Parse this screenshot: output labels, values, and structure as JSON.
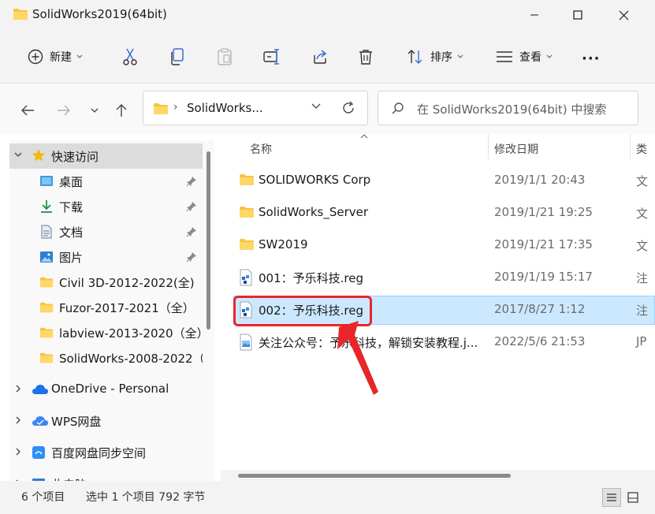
{
  "window": {
    "title": "SolidWorks2019(64bit)",
    "folder_color": "#f4c542"
  },
  "toolbar": {
    "new_label": "新建",
    "sort_label": "排序",
    "view_label": "查看",
    "more_label": "···"
  },
  "address": {
    "separator": "›",
    "path": "SolidWorks...",
    "search_placeholder": "在 SolidWorks2019(64bit) 中搜索"
  },
  "nav": {
    "quick_access": "快速访问",
    "items": [
      {
        "label": "桌面",
        "icon": "desktop-icon",
        "pinned": true
      },
      {
        "label": "下载",
        "icon": "download-icon",
        "pinned": true
      },
      {
        "label": "文档",
        "icon": "document-icon",
        "pinned": true
      },
      {
        "label": "图片",
        "icon": "pictures-icon",
        "pinned": true
      },
      {
        "label": "Civil 3D-2012-2022(全)",
        "icon": "folder-icon",
        "pinned": false
      },
      {
        "label": "Fuzor-2017-2021（全）",
        "icon": "folder-icon",
        "pinned": false
      },
      {
        "label": "labview-2013-2020（全）",
        "icon": "folder-icon",
        "pinned": false
      },
      {
        "label": "SolidWorks-2008-2022（",
        "icon": "folder-icon",
        "pinned": false
      }
    ],
    "onedrive": "OneDrive - Personal",
    "wps": "WPS网盘",
    "baidu": "百度网盘同步空间",
    "thispc": "此电脑"
  },
  "columns": {
    "name": "名称",
    "date": "修改日期",
    "type": "类"
  },
  "files": [
    {
      "name": "SOLIDWORKS Corp",
      "date": "2019/1/1 20:43",
      "type": "文",
      "icon": "folder-icon"
    },
    {
      "name": "SolidWorks_Server",
      "date": "2019/1/21 19:25",
      "type": "文",
      "icon": "folder-icon"
    },
    {
      "name": "SW2019",
      "date": "2019/1/21 17:35",
      "type": "文",
      "icon": "folder-icon"
    },
    {
      "name": "001：予乐科技.reg",
      "date": "2019/1/19 15:17",
      "type": "注",
      "icon": "registry-icon"
    },
    {
      "name": "002：予乐科技.reg",
      "date": "2017/8/27 1:12",
      "type": "注",
      "icon": "registry-icon",
      "selected": true
    },
    {
      "name": "关注公众号：予乐科技，解锁安装教程.j...",
      "date": "2022/5/6 21:53",
      "type": "JP",
      "icon": "image-file-icon"
    }
  ],
  "status": {
    "count": "6 个项目",
    "selection": "选中 1 个项目  792 字节"
  },
  "colors": {
    "selection_bg": "#cce8ff",
    "annotation_red": "#e8262a",
    "accent_blue": "#0067c0"
  }
}
